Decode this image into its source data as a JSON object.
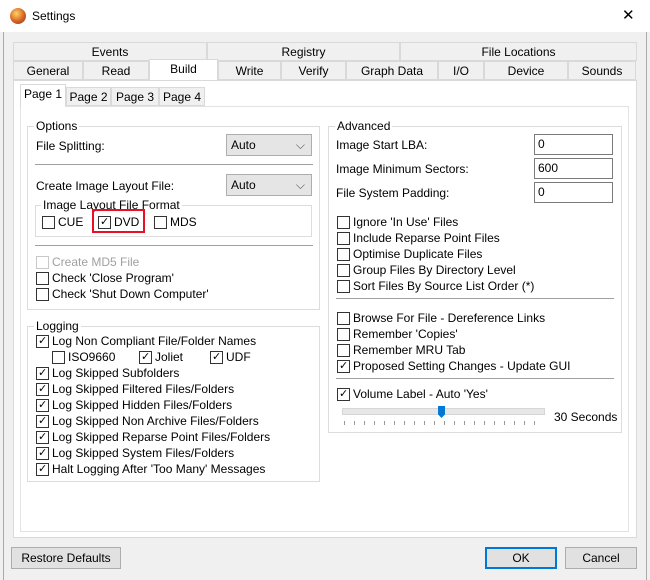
{
  "window": {
    "title": "Settings",
    "close": "✕"
  },
  "tabs_row1": [
    "Events",
    "Registry",
    "File Locations"
  ],
  "tabs_row2": [
    "General",
    "Read",
    "Build",
    "Write",
    "Verify",
    "Graph Data",
    "I/O",
    "Device",
    "Sounds"
  ],
  "active_tab": "Build",
  "pages": [
    "Page 1",
    "Page 2",
    "Page 3",
    "Page 4"
  ],
  "options": {
    "title": "Options",
    "file_splitting_label": "File Splitting:",
    "file_splitting_value": "Auto",
    "create_layout_label": "Create Image Layout File:",
    "create_layout_value": "Auto",
    "format_group": "Image Layout File Format",
    "formats": [
      {
        "label": "CUE",
        "checked": false
      },
      {
        "label": "DVD",
        "checked": true
      },
      {
        "label": "MDS",
        "checked": false
      }
    ],
    "checks": [
      {
        "label": "Create MD5 File",
        "checked": false,
        "disabled": true
      },
      {
        "label": "Check 'Close Program'",
        "checked": false
      },
      {
        "label": "Check 'Shut Down Computer'",
        "checked": false
      }
    ]
  },
  "logging": {
    "title": "Logging",
    "non_compliant": "Log Non Compliant File/Folder Names",
    "sub": [
      {
        "label": "ISO9660",
        "checked": false
      },
      {
        "label": "Joliet",
        "checked": true
      },
      {
        "label": "UDF",
        "checked": true
      }
    ],
    "checks": [
      "Log Skipped Subfolders",
      "Log Skipped Filtered Files/Folders",
      "Log Skipped Hidden Files/Folders",
      "Log Skipped Non Archive Files/Folders",
      "Log Skipped Reparse Point Files/Folders",
      "Log Skipped System Files/Folders",
      "Halt Logging After 'Too Many' Messages"
    ]
  },
  "advanced": {
    "title": "Advanced",
    "fields": [
      {
        "label": "Image Start LBA:",
        "value": "0"
      },
      {
        "label": "Image Minimum Sectors:",
        "value": "600"
      },
      {
        "label": "File System Padding:",
        "value": "0"
      }
    ],
    "group1": [
      {
        "label": "Ignore 'In Use' Files",
        "checked": false
      },
      {
        "label": "Include Reparse Point Files",
        "checked": false
      },
      {
        "label": "Optimise Duplicate Files",
        "checked": false
      },
      {
        "label": "Group Files By Directory Level",
        "checked": false
      },
      {
        "label": "Sort Files By Source List Order (*)",
        "checked": false
      }
    ],
    "group2": [
      {
        "label": "Browse For File - Dereference Links",
        "checked": false
      },
      {
        "label": "Remember 'Copies'",
        "checked": false
      },
      {
        "label": "Remember MRU Tab",
        "checked": false
      },
      {
        "label": "Proposed Setting Changes - Update GUI",
        "checked": true
      }
    ],
    "volume_label": {
      "label": "Volume Label - Auto 'Yes'",
      "checked": true
    },
    "slider_fraction": 0.49,
    "slider_text": "30 Seconds"
  },
  "buttons": {
    "restore": "Restore Defaults",
    "ok": "OK",
    "cancel": "Cancel"
  },
  "colors": {
    "highlight": "#e81123",
    "accent": "#0078d7"
  }
}
